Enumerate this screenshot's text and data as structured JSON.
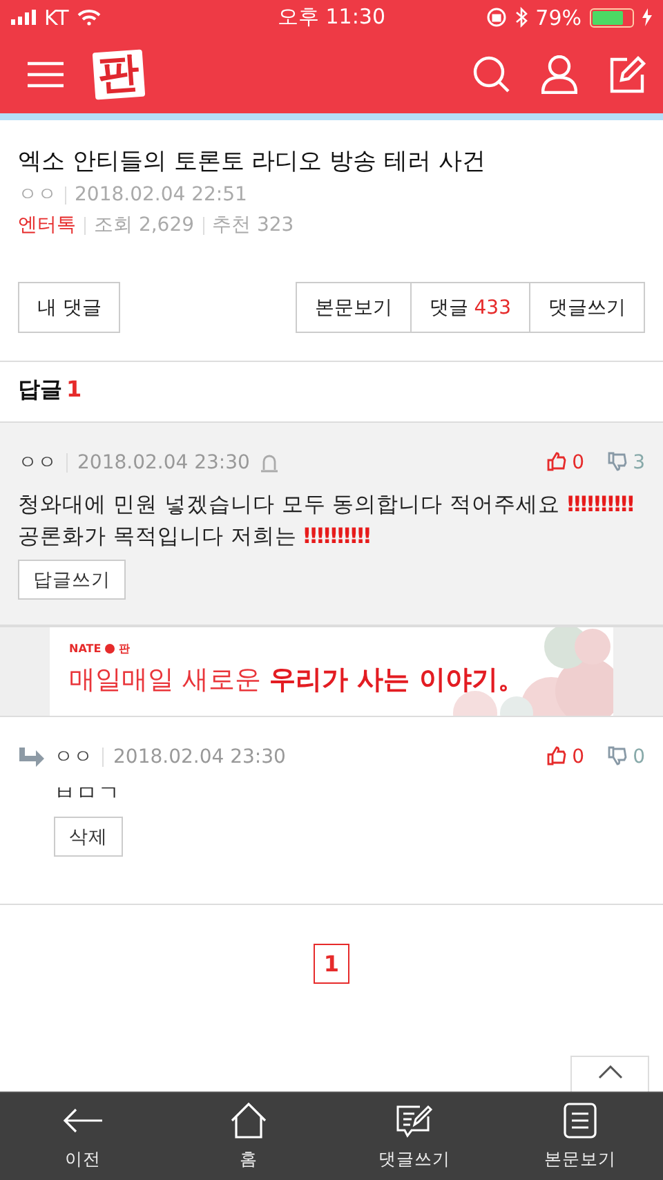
{
  "status_bar": {
    "carrier": "KT",
    "time": "오후 11:30",
    "battery": "79%"
  },
  "header": {
    "logo": "판"
  },
  "post": {
    "title": "엑소 안티들의 토론토 라디오 방송 테러 사건",
    "author": "ㅇㅇ",
    "date": "2018.02.04 22:51",
    "category": "엔터톡",
    "views": "조회 2,629",
    "recommend": "추천 323"
  },
  "actions": {
    "my_comments": "내 댓글",
    "buttons": [
      {
        "label": "본문보기"
      },
      {
        "label": "댓글",
        "count": "433"
      },
      {
        "label": "댓글쓰기"
      }
    ]
  },
  "replies": {
    "label": "답글",
    "count": "1"
  },
  "thread": [
    {
      "kind": "comment",
      "author": "ㅇㅇ",
      "date": "2018.02.04 23:30",
      "likes": "0",
      "dislikes": "3",
      "body": [
        {
          "kind": "text",
          "text": "청와대에 민원 넣겠습니다 모두 동의합니다 적어주세요 "
        },
        {
          "kind": "emoji",
          "text": "‼‼‼‼‼"
        },
        {
          "kind": "text",
          "text": " 공론화가 목적입니다 저희는 "
        },
        {
          "kind": "emoji",
          "text": "‼‼‼‼‼"
        }
      ],
      "button": "답글쓰기"
    },
    {
      "kind": "banner",
      "brand": "NATE",
      "brand_sub": "판",
      "text": "매일매일 새로운 **우리가 사는 이야기。**"
    },
    {
      "kind": "reply",
      "author": "ㅇㅇ",
      "date": "2018.02.04 23:30",
      "likes": "0",
      "dislikes": "0",
      "body": [
        {
          "kind": "text",
          "text": "ㅂㅁㄱ"
        }
      ],
      "button": "삭제"
    }
  ],
  "pagination": [
    {
      "label": "1",
      "selected": true
    }
  ],
  "bottom_nav": [
    {
      "label": "이전"
    },
    {
      "label": "홈"
    },
    {
      "label": "댓글쓰기"
    },
    {
      "label": "본문보기"
    }
  ]
}
